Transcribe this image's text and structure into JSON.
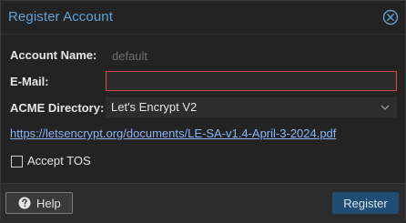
{
  "window": {
    "title": "Register Account"
  },
  "form": {
    "account_name": {
      "label": "Account Name:",
      "placeholder": "default"
    },
    "email": {
      "label": "E-Mail:",
      "value": ""
    },
    "acme_directory": {
      "label": "ACME Directory:",
      "value": "Let's Encrypt V2"
    },
    "tos_url": "https://letsencrypt.org/documents/LE-SA-v1.4-April-3-2024.pdf",
    "accept_tos": {
      "label": "Accept TOS",
      "checked": false
    }
  },
  "footer": {
    "help_label": "Help",
    "register_label": "Register"
  },
  "icons": {
    "close": "close-icon",
    "help": "question-circle-icon",
    "dropdown": "chevron-down-icon"
  },
  "colors": {
    "accent": "#5ea2d6",
    "error_border": "#d14a4a",
    "primary_button": "#1f4d74",
    "link": "#8ab4f8"
  }
}
